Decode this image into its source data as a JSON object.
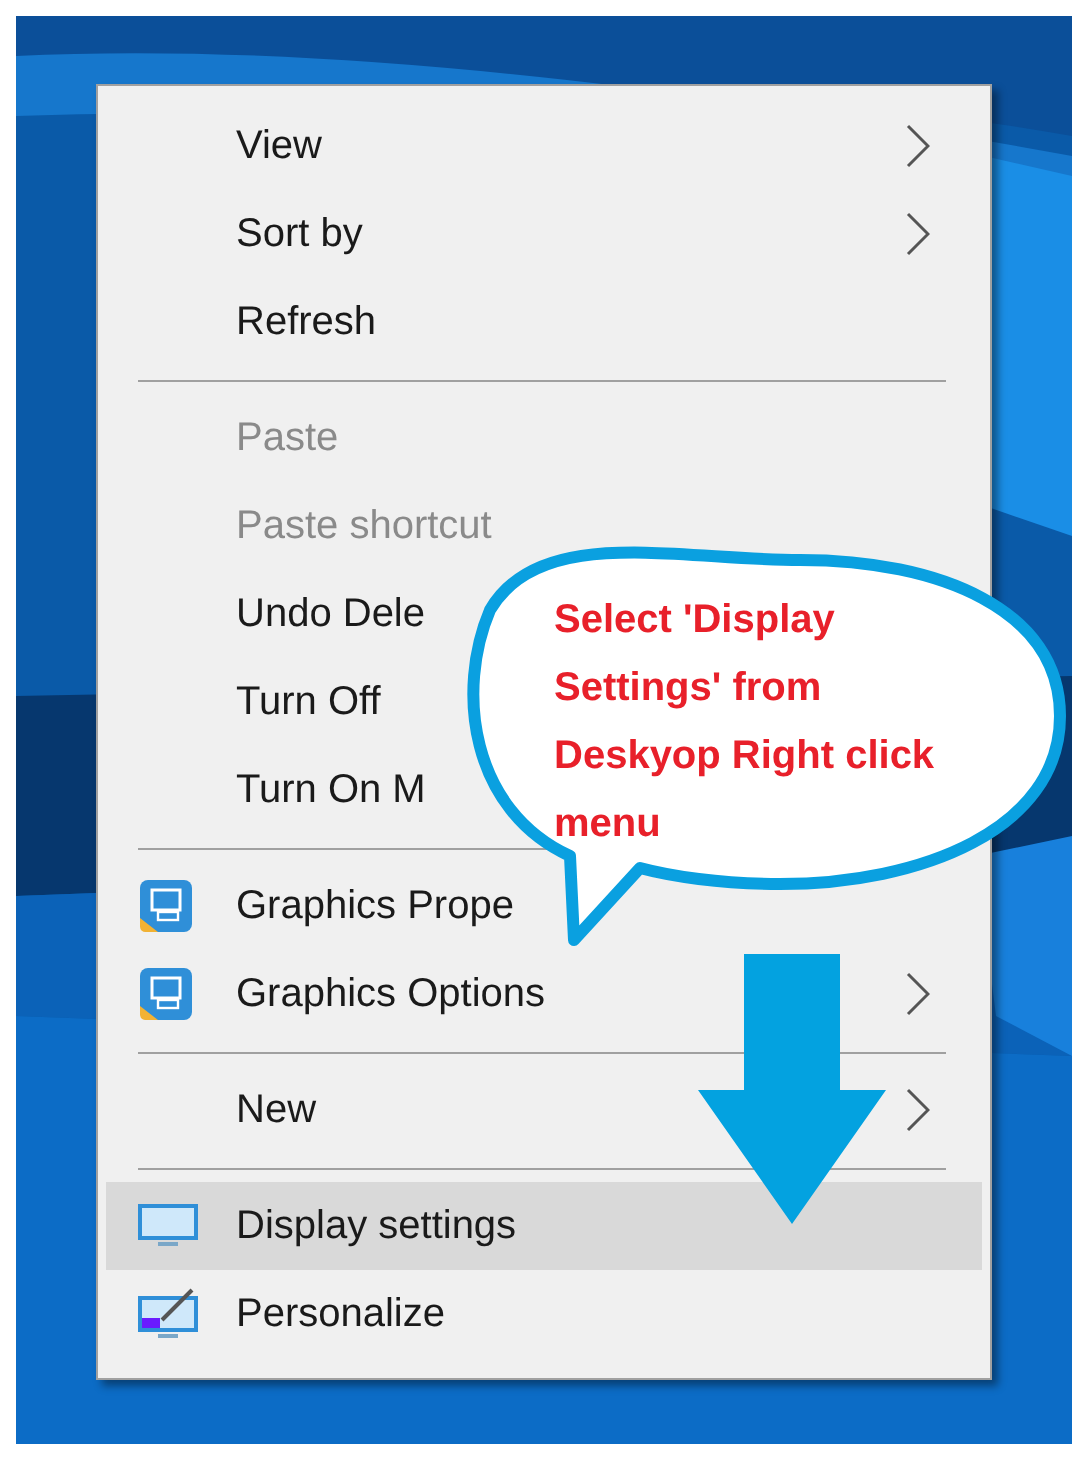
{
  "context_menu": {
    "items": [
      {
        "kind": "item",
        "label": "View",
        "submenu": true,
        "disabled": false,
        "selected": false
      },
      {
        "kind": "item",
        "label": "Sort by",
        "submenu": true,
        "disabled": false,
        "selected": false
      },
      {
        "kind": "item",
        "label": "Refresh",
        "submenu": false,
        "disabled": false,
        "selected": false
      },
      {
        "kind": "separator"
      },
      {
        "kind": "item",
        "label": "Paste",
        "submenu": false,
        "disabled": true,
        "selected": false
      },
      {
        "kind": "item",
        "label": "Paste shortcut",
        "submenu": false,
        "disabled": true,
        "selected": false
      },
      {
        "kind": "item",
        "label": "Undo Dele",
        "disabled": false,
        "selected": false
      },
      {
        "kind": "item",
        "label": "Turn Off",
        "disabled": false,
        "selected": false
      },
      {
        "kind": "item",
        "label": "Turn On M",
        "disabled": false,
        "selected": false
      },
      {
        "kind": "separator"
      },
      {
        "kind": "item",
        "label": "Graphics Prope",
        "submenu": false,
        "disabled": false,
        "selected": false
      },
      {
        "kind": "item",
        "label": "Graphics Options",
        "submenu": true,
        "disabled": false,
        "selected": false
      },
      {
        "kind": "separator"
      },
      {
        "kind": "item",
        "label": "New",
        "submenu": true,
        "disabled": false,
        "selected": false
      },
      {
        "kind": "separator"
      },
      {
        "kind": "item",
        "label": "Display settings",
        "submenu": false,
        "disabled": false,
        "selected": true
      },
      {
        "kind": "item",
        "label": "Personalize",
        "submenu": false,
        "disabled": false,
        "selected": false
      }
    ]
  },
  "callout": {
    "lines": [
      "Select 'Display",
      "Settings' from",
      "Deskyop Right click",
      "menu"
    ]
  }
}
